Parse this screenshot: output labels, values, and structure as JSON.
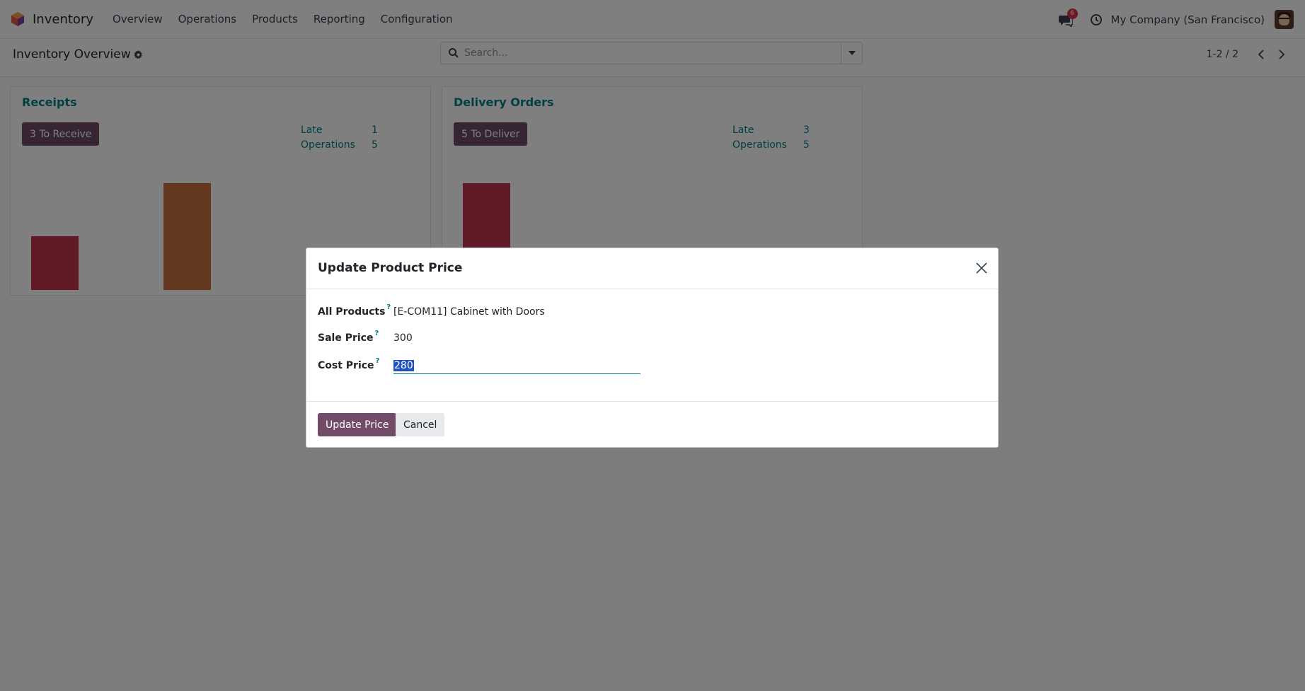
{
  "navbar": {
    "app_name": "Inventory",
    "menu": [
      "Overview",
      "Operations",
      "Products",
      "Reporting",
      "Configuration"
    ],
    "chat_badge": "6",
    "company": "My Company (San Francisco)"
  },
  "control_panel": {
    "title": "Inventory Overview",
    "search_placeholder": "Search...",
    "pager": "1-2 / 2"
  },
  "cards": [
    {
      "title": "Receipts",
      "button": "3 To Receive",
      "stats": [
        {
          "label": "Late",
          "value": "1"
        },
        {
          "label": "Operations",
          "value": "5"
        }
      ]
    },
    {
      "title": "Delivery Orders",
      "button": "5 To Deliver",
      "stats": [
        {
          "label": "Late",
          "value": "3"
        },
        {
          "label": "Operations",
          "value": "5"
        }
      ]
    }
  ],
  "modal": {
    "title": "Update Product Price",
    "fields": [
      {
        "label": "All Products",
        "help": "?",
        "value": "[E-COM11] Cabinet with Doors"
      },
      {
        "label": "Sale Price",
        "help": "?",
        "value": "300"
      },
      {
        "label": "Cost Price",
        "help": "?",
        "value": "280"
      }
    ],
    "primary_button": "Update Price",
    "secondary_button": "Cancel"
  },
  "colors": {
    "brand": "#714b67",
    "teal": "#017e84",
    "bar_red": "#c1334a",
    "bar_orange": "#c8703c"
  }
}
